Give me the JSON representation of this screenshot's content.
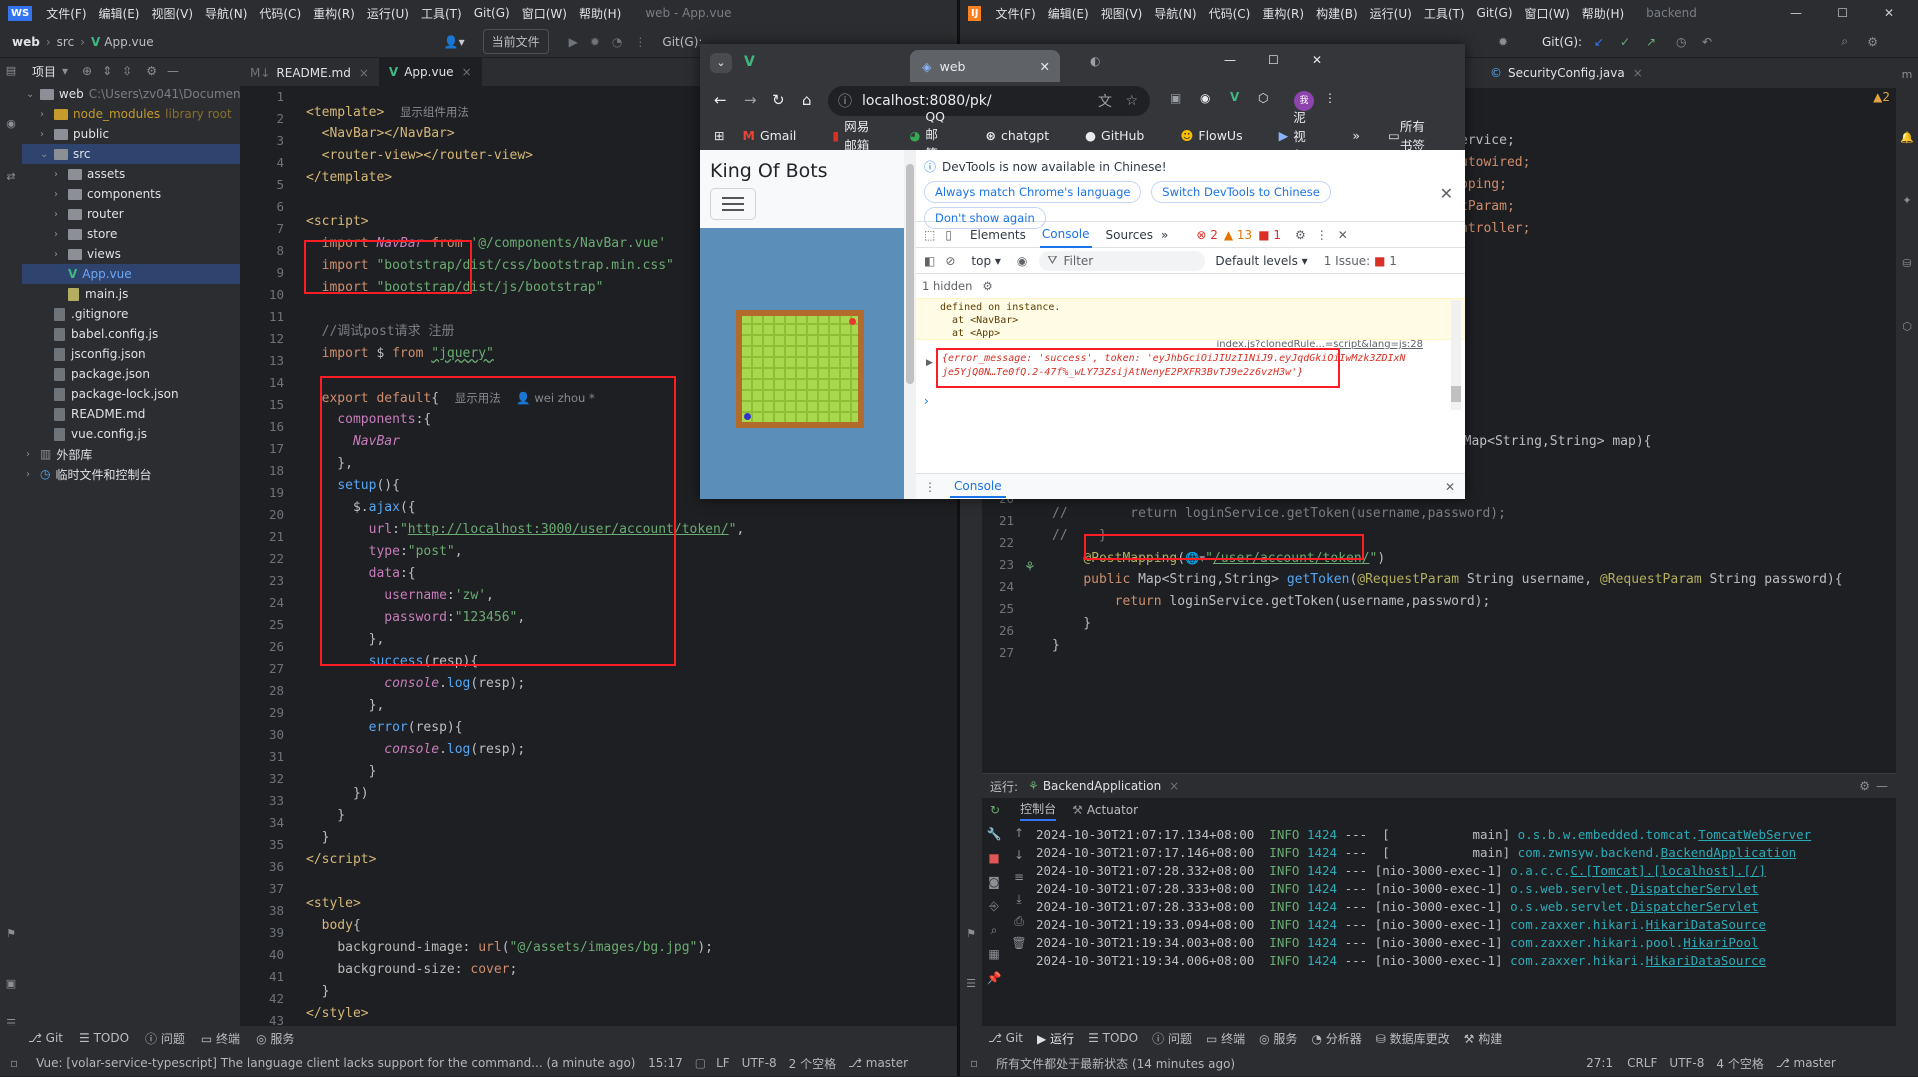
{
  "left_ide": {
    "project_name": "web",
    "breadcrumb": [
      "web",
      "src",
      "App.vue"
    ],
    "window_title": "web - App.vue",
    "menu": [
      "文件(F)",
      "编辑(E)",
      "视图(V)",
      "导航(N)",
      "代码(C)",
      "重构(R)",
      "运行(U)",
      "工具(T)",
      "Git(G)",
      "窗口(W)",
      "帮助(H)"
    ],
    "toolbar_current_file": "当前文件",
    "toolbar_git": "Git(G):",
    "project_panel_title": "项目",
    "tree": [
      {
        "label": "web",
        "extra": "C:\\Users\\zv041\\Documen",
        "type": "folder",
        "indent": 0
      },
      {
        "label": "node_modules",
        "extra": "library root",
        "type": "folder-lib",
        "indent": 1
      },
      {
        "label": "public",
        "extra": "",
        "type": "folder",
        "indent": 1
      },
      {
        "label": "src",
        "extra": "",
        "type": "folder",
        "indent": 1
      },
      {
        "label": "assets",
        "extra": "",
        "type": "folder",
        "indent": 2
      },
      {
        "label": "components",
        "extra": "",
        "type": "folder",
        "indent": 2
      },
      {
        "label": "router",
        "extra": "",
        "type": "folder",
        "indent": 2
      },
      {
        "label": "store",
        "extra": "",
        "type": "folder",
        "indent": 2
      },
      {
        "label": "views",
        "extra": "",
        "type": "folder",
        "indent": 2
      },
      {
        "label": "App.vue",
        "extra": "",
        "type": "vue",
        "indent": 2
      },
      {
        "label": "main.js",
        "extra": "",
        "type": "js",
        "indent": 2
      },
      {
        "label": ".gitignore",
        "extra": "",
        "type": "file",
        "indent": 1
      },
      {
        "label": "babel.config.js",
        "extra": "",
        "type": "file",
        "indent": 1
      },
      {
        "label": "jsconfig.json",
        "extra": "",
        "type": "file",
        "indent": 1
      },
      {
        "label": "package.json",
        "extra": "",
        "type": "file",
        "indent": 1
      },
      {
        "label": "package-lock.json",
        "extra": "",
        "type": "file",
        "indent": 1
      },
      {
        "label": "README.md",
        "extra": "",
        "type": "file",
        "indent": 1
      },
      {
        "label": "vue.config.js",
        "extra": "",
        "type": "file",
        "indent": 1
      },
      {
        "label": "外部库",
        "extra": "",
        "type": "lib",
        "indent": 0
      },
      {
        "label": "临时文件和控制台",
        "extra": "",
        "type": "scratch",
        "indent": 0
      }
    ],
    "tabs": [
      {
        "label": "README.md",
        "active": false
      },
      {
        "label": "App.vue",
        "active": true
      }
    ],
    "line_numbers": [
      "1",
      "2",
      "3",
      "4",
      "5",
      "6",
      "7",
      "8",
      "9",
      "10",
      "11",
      "12",
      "13",
      "14",
      "15",
      "16",
      "17",
      "18",
      "19",
      "20",
      "21",
      "22",
      "23",
      "24",
      "25",
      "26",
      "27",
      "28",
      "29",
      "30",
      "31",
      "32",
      "33",
      "34",
      "35",
      "36",
      "37",
      "38",
      "39",
      "40",
      "41",
      "42",
      "43"
    ],
    "hints": {
      "usage": "显示组件用法",
      "usage2": "显示用法",
      "author": "wei zhou *"
    },
    "statusbar": {
      "message": "Vue: [volar-service-typescript] The language client lacks support for the command... (a minute ago)",
      "position": "15:17",
      "line_sep": "LF",
      "encoding": "UTF-8",
      "indent": "2 个空格",
      "branch": "master"
    },
    "bottom_tools": [
      "Git",
      "TODO",
      "问题",
      "终端",
      "服务"
    ]
  },
  "right_ide": {
    "menu": [
      "文件(F)",
      "编辑(E)",
      "视图(V)",
      "导航(N)",
      "代码(C)",
      "重构(R)",
      "构建(B)",
      "运行(U)",
      "工具(T)",
      "Git(G)",
      "窗口(W)",
      "帮助(H)"
    ],
    "window_title": "backend",
    "toolbar_git": "Git(G):",
    "tab": "SecurityConfig.java",
    "warnings": "▲2",
    "code_suffixes": [
      "ervice;",
      "utowired;",
      "pping;",
      "tParam;",
      "ntroller;"
    ],
    "code_fragment_mapping": "m Map<String,String> map){",
    "line_numbers": [
      "20",
      "21",
      "22",
      "23",
      "24",
      "25",
      "26",
      "27"
    ],
    "run_panel": {
      "label": "运行:",
      "app": "BackendApplication",
      "tabs": [
        "控制台",
        "Actuator"
      ],
      "logs": [
        {
          "ts": "2024-10-30T21:07:17.134+08:00",
          "level": "INFO",
          "pid": "1424",
          "thread": "---  [           main]",
          "logger": "o.s.b.w.embedded.tomcat.",
          "link": "TomcatWebServer"
        },
        {
          "ts": "2024-10-30T21:07:17.146+08:00",
          "level": "INFO",
          "pid": "1424",
          "thread": "---  [           main]",
          "logger": "com.zwnsyw.backend.",
          "link": "BackendApplication"
        },
        {
          "ts": "2024-10-30T21:07:28.332+08:00",
          "level": "INFO",
          "pid": "1424",
          "thread": "--- [nio-3000-exec-1]",
          "logger": "o.a.c.c.",
          "link": "C.[Tomcat].[localhost].[/]"
        },
        {
          "ts": "2024-10-30T21:07:28.333+08:00",
          "level": "INFO",
          "pid": "1424",
          "thread": "--- [nio-3000-exec-1]",
          "logger": "o.s.web.servlet.",
          "link": "DispatcherServlet"
        },
        {
          "ts": "2024-10-30T21:07:28.333+08:00",
          "level": "INFO",
          "pid": "1424",
          "thread": "--- [nio-3000-exec-1]",
          "logger": "o.s.web.servlet.",
          "link": "DispatcherServlet"
        },
        {
          "ts": "2024-10-30T21:19:33.094+08:00",
          "level": "INFO",
          "pid": "1424",
          "thread": "--- [nio-3000-exec-1]",
          "logger": "com.zaxxer.hikari.",
          "link": "HikariDataSource"
        },
        {
          "ts": "2024-10-30T21:19:34.003+08:00",
          "level": "INFO",
          "pid": "1424",
          "thread": "--- [nio-3000-exec-1]",
          "logger": "com.zaxxer.hikari.pool.",
          "link": "HikariPool"
        },
        {
          "ts": "2024-10-30T21:19:34.006+08:00",
          "level": "INFO",
          "pid": "1424",
          "thread": "--- [nio-3000-exec-1]",
          "logger": "com.zaxxer.hikari.",
          "link": "HikariDataSource"
        }
      ]
    },
    "bottom_tools": [
      "Git",
      "运行",
      "TODO",
      "问题",
      "终端",
      "服务",
      "分析器",
      "数据库更改",
      "构建"
    ],
    "statusbar": {
      "message": "所有文件都处于最新状态 (14 minutes ago)",
      "position": "27:1",
      "line_sep": "CRLF",
      "encoding": "UTF-8",
      "indent": "4 个空格",
      "branch": "master"
    }
  },
  "chrome": {
    "tab_title": "web",
    "url": "localhost:8080/pk/",
    "bookmarks": [
      "Gmail",
      "网易邮箱",
      "QQ邮箱",
      "chatgpt",
      "GitHub",
      "FlowUs",
      "泥视频"
    ],
    "bookmarks_all": "所有书签",
    "page_brand": "King Of Bots",
    "devtools": {
      "banner": "DevTools is now available in Chinese!",
      "btn_match": "Always match Chrome's language",
      "btn_switch": "Switch DevTools to Chinese",
      "btn_dont": "Don't show again",
      "tabs": [
        "Elements",
        "Console",
        "Sources"
      ],
      "errors": "2",
      "warnings": "13",
      "issues_badge": "1",
      "context": "top",
      "filter_placeholder": "Filter",
      "levels": "Default levels",
      "issues": "1 Issue:",
      "issues_count": "1",
      "hidden": "1 hidden",
      "warn_lines": [
        "defined on instance.",
        "  at <NavBar>",
        "  at <App>"
      ],
      "source_link": "index.js?clonedRule...=script&lang=js:28",
      "log_object_line1": "{error_message: 'success', token: 'eyJhbGciOiJIUzI1NiJ9.eyJqdGkiOiIwMzk3ZDIxN",
      "log_object_line2": "je5YjQ0N…Te0fQ.2-47f%_wLY73ZsijAtNenyE2PXFR3BvTJ9e2z6vzH3w'}",
      "drawer": "Console"
    }
  }
}
